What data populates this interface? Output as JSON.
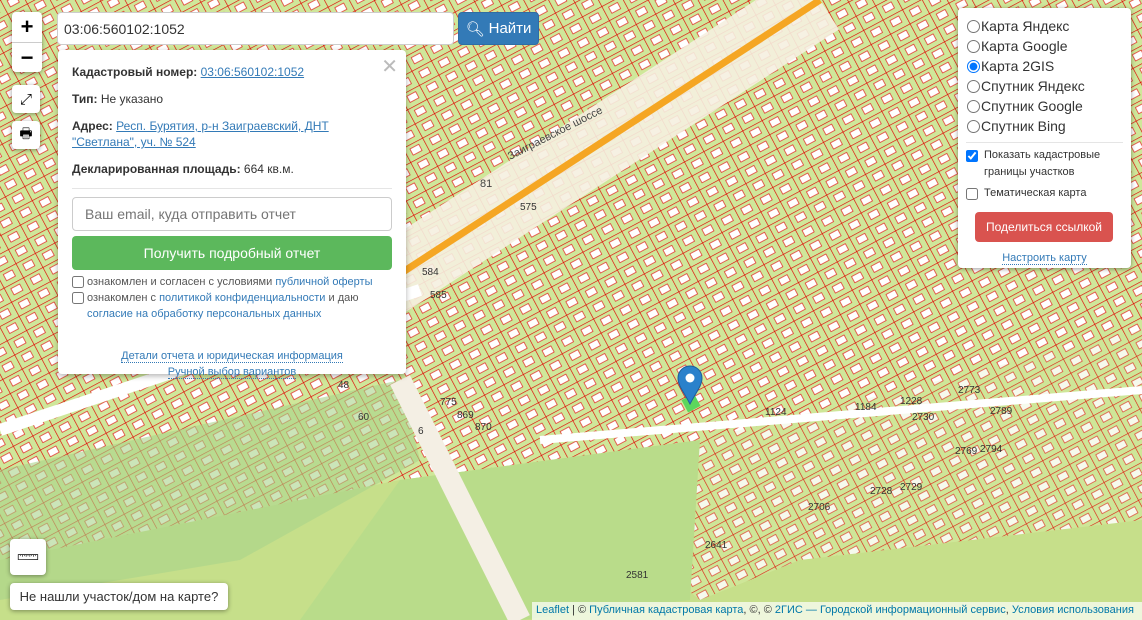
{
  "search": {
    "value": "03:06:560102:1052",
    "button": "Найти"
  },
  "zoom": {
    "in": "+",
    "out": "−"
  },
  "popup": {
    "cadastral_label": "Кадастровый номер:",
    "cadastral_value": "03:06:560102:1052",
    "type_label": "Тип:",
    "type_value": "Не указано",
    "address_label": "Адрес:",
    "address_value": "Респ. Бурятия, р-н Заиграевский, ДНТ \"Светлана\", уч. № 524",
    "area_label": "Декларированная площадь:",
    "area_value": "664 кв.м.",
    "email_placeholder": "Ваш email, куда отправить отчет",
    "report_button": "Получить подробный отчет",
    "consent1_text": "ознакомлен и согласен с условиями ",
    "consent1_link": "публичной оферты",
    "consent2_text": "ознакомлен с ",
    "consent2_link": "политикой конфиденциальности",
    "consent2_mid": " и даю ",
    "consent2_link2": "согласие на обработку персональных данных",
    "details_link": "Детали отчета и юридическая информация",
    "manual_link": "Ручной выбор вариантов"
  },
  "layers": {
    "options": [
      "Карта Яндекс",
      "Карта Google",
      "Карта 2GIS",
      "Спутник Яндекс",
      "Спутник Google",
      "Спутник Bing"
    ],
    "selected": "Карта 2GIS",
    "show_borders": "Показать кадастровые границы участков",
    "thematic": "Тематическая карта",
    "share": "Поделиться ссылкой",
    "configure": "Настроить карту"
  },
  "map": {
    "road_label": "Заиграевское шоссе",
    "road_number": "81",
    "labels": [
      "48",
      "60",
      "775",
      "869",
      "870",
      "6",
      "1124",
      "1184",
      "1228",
      "2730",
      "2773",
      "2789",
      "2728",
      "2729",
      "2769",
      "2794",
      "2706",
      "2581",
      "2641",
      "575",
      "584",
      "585"
    ]
  },
  "not_found": "Не нашли участок/дом на карте?",
  "attribution": {
    "leaflet": "Leaflet",
    "sep": " | © ",
    "pkk": "Публичная кадастровая карта",
    "mid": ", ©, © ",
    "gis": "2ГИС — Городской информационный сервис",
    "comma": ", ",
    "terms": "Условия использования"
  },
  "colors": {
    "parcel": "#e00000",
    "primary": "#337ab7",
    "success": "#5cb85c",
    "danger": "#d9534f"
  }
}
